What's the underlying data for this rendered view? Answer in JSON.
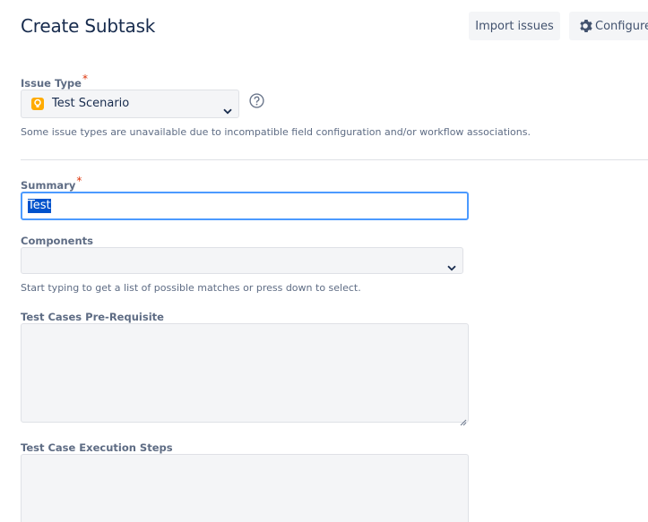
{
  "header": {
    "title": "Create Subtask",
    "import_label": "Import issues",
    "configure_label": "Configure"
  },
  "issue_type": {
    "label": "Issue Type",
    "required_mark": "*",
    "value": "Test Scenario",
    "icon": "lightbulb-icon",
    "hint": "Some issue types are unavailable due to incompatible field configuration and/or workflow associations."
  },
  "summary": {
    "label": "Summary",
    "required_mark": "*",
    "value": "Test"
  },
  "components": {
    "label": "Components",
    "value": "",
    "hint": "Start typing to get a list of possible matches or press down to select."
  },
  "prerequisite": {
    "label": "Test Cases Pre-Requisite",
    "value": ""
  },
  "execution_steps": {
    "label": "Test Case Execution Steps",
    "value": ""
  },
  "colors": {
    "accent": "#0052cc",
    "focus_border": "#4c9aff",
    "required": "#de350b",
    "issue_icon": "#ffab00"
  }
}
